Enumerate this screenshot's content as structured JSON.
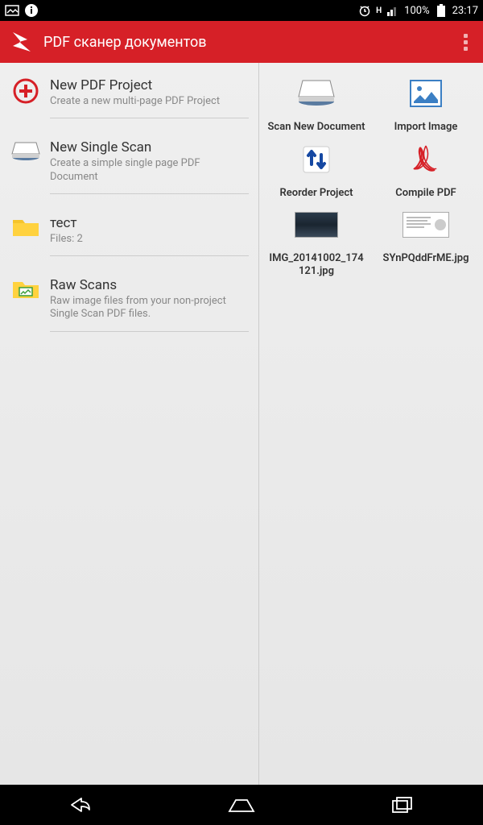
{
  "status": {
    "battery": "100%",
    "time": "23:17",
    "network_indicator": "H"
  },
  "appbar": {
    "title": "PDF сканер документов"
  },
  "sidebar": {
    "items": [
      {
        "title": "New PDF Project",
        "sub": "Create a new multi-page PDF Project",
        "icon": "plus-circle"
      },
      {
        "title": "New Single Scan",
        "sub": "Create a simple single page PDF Document",
        "icon": "scanner"
      },
      {
        "title": "тест",
        "sub": "Files: 2",
        "icon": "folder"
      },
      {
        "title": "Raw Scans",
        "sub": "Raw image files from your non-project Single Scan PDF files.",
        "icon": "folder-image"
      }
    ]
  },
  "grid": {
    "items": [
      {
        "label": "Scan New Document",
        "icon": "scanner"
      },
      {
        "label": "Import Image",
        "icon": "image"
      },
      {
        "label": "Reorder Project",
        "icon": "reorder-arrows"
      },
      {
        "label": "Compile PDF",
        "icon": "pdf"
      },
      {
        "label": "IMG_20141002_174121.jpg",
        "icon": "thumb-dark"
      },
      {
        "label": "SYnPQddFrME.jpg",
        "icon": "thumb-light"
      }
    ]
  }
}
